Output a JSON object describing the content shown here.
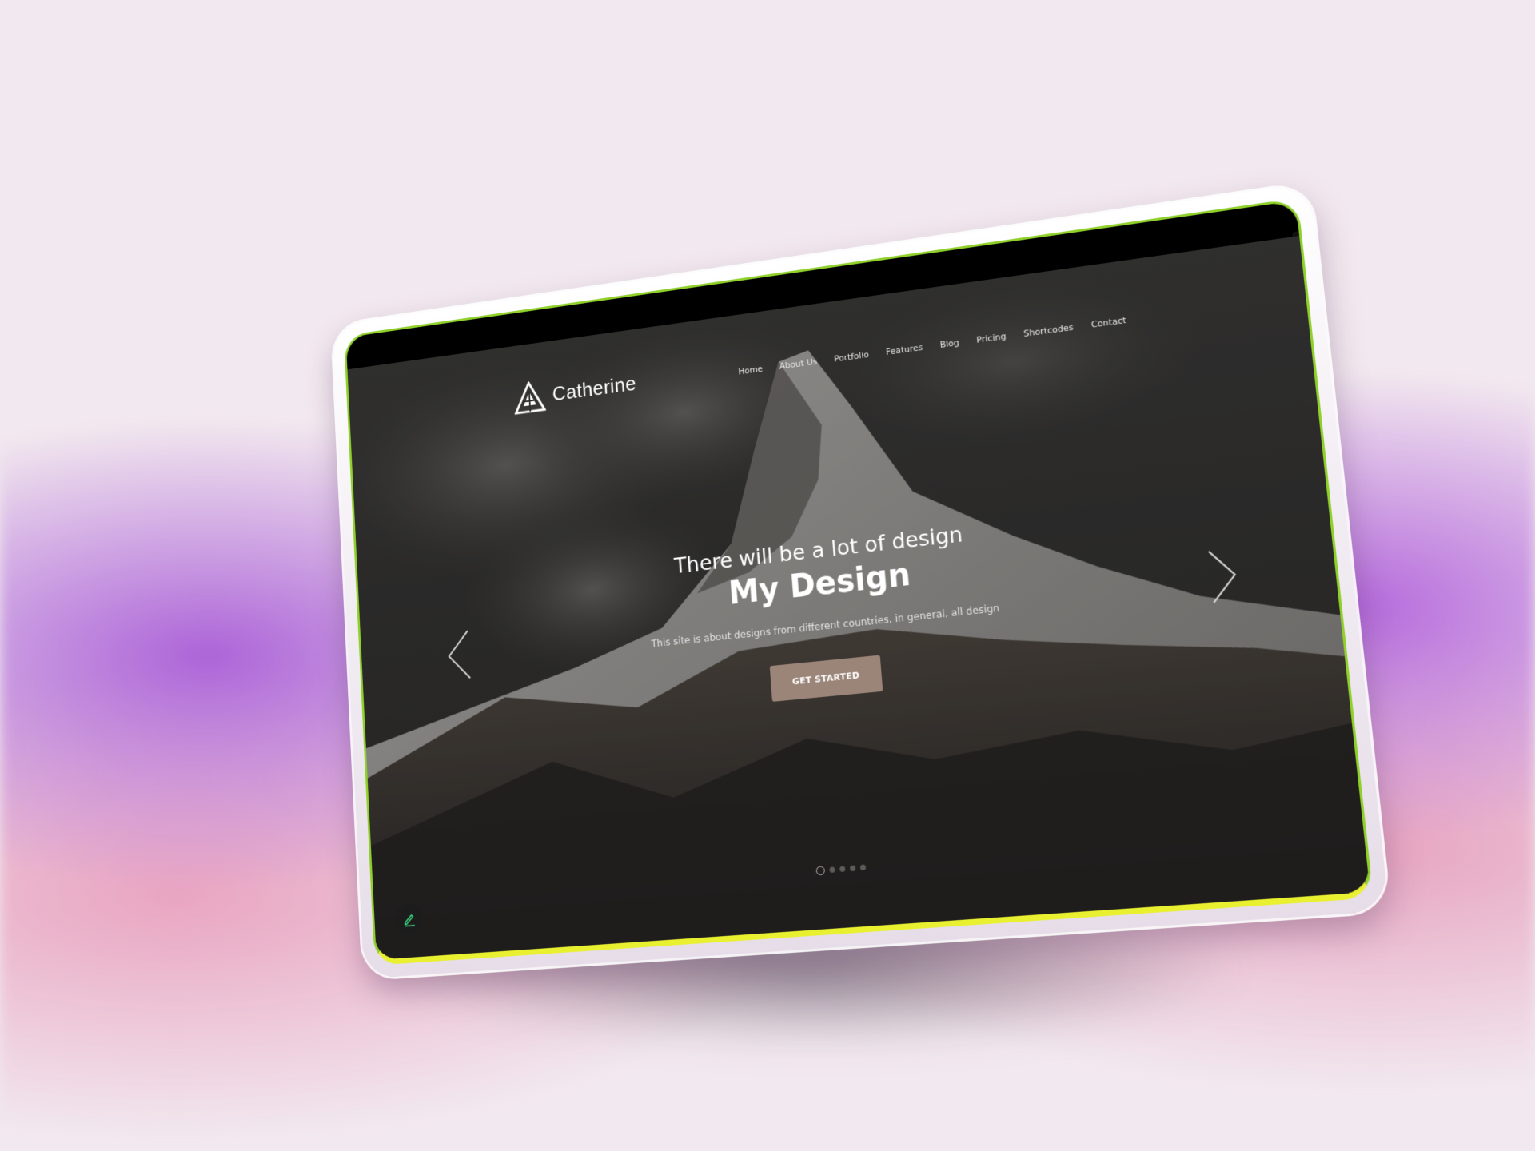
{
  "site": {
    "brand": "Catherine",
    "nav": [
      "Home",
      "About Us",
      "Portfolio",
      "Features",
      "Blog",
      "Pricing",
      "Shortcodes",
      "Contact"
    ]
  },
  "hero": {
    "subtitle": "There will be a lot of design",
    "title": "My Design",
    "description": "This site is about designs from different countries, in general, all design",
    "cta_label": "GET STARTED",
    "slide_count": 5,
    "active_slide": 1
  },
  "colors": {
    "background": "#f2e8ef",
    "accent_button": "#9b8579",
    "screen_border_top": "#8fd02a",
    "screen_border_bottom": "#e8f030",
    "glow_purple": "#a85cd6",
    "glow_pink": "#e8a0be",
    "edit_icon": "#3ddc84"
  },
  "icons": {
    "logo": "triangle-logo-icon",
    "prev": "chevron-left-icon",
    "next": "chevron-right-icon",
    "edit": "pencil-icon"
  }
}
